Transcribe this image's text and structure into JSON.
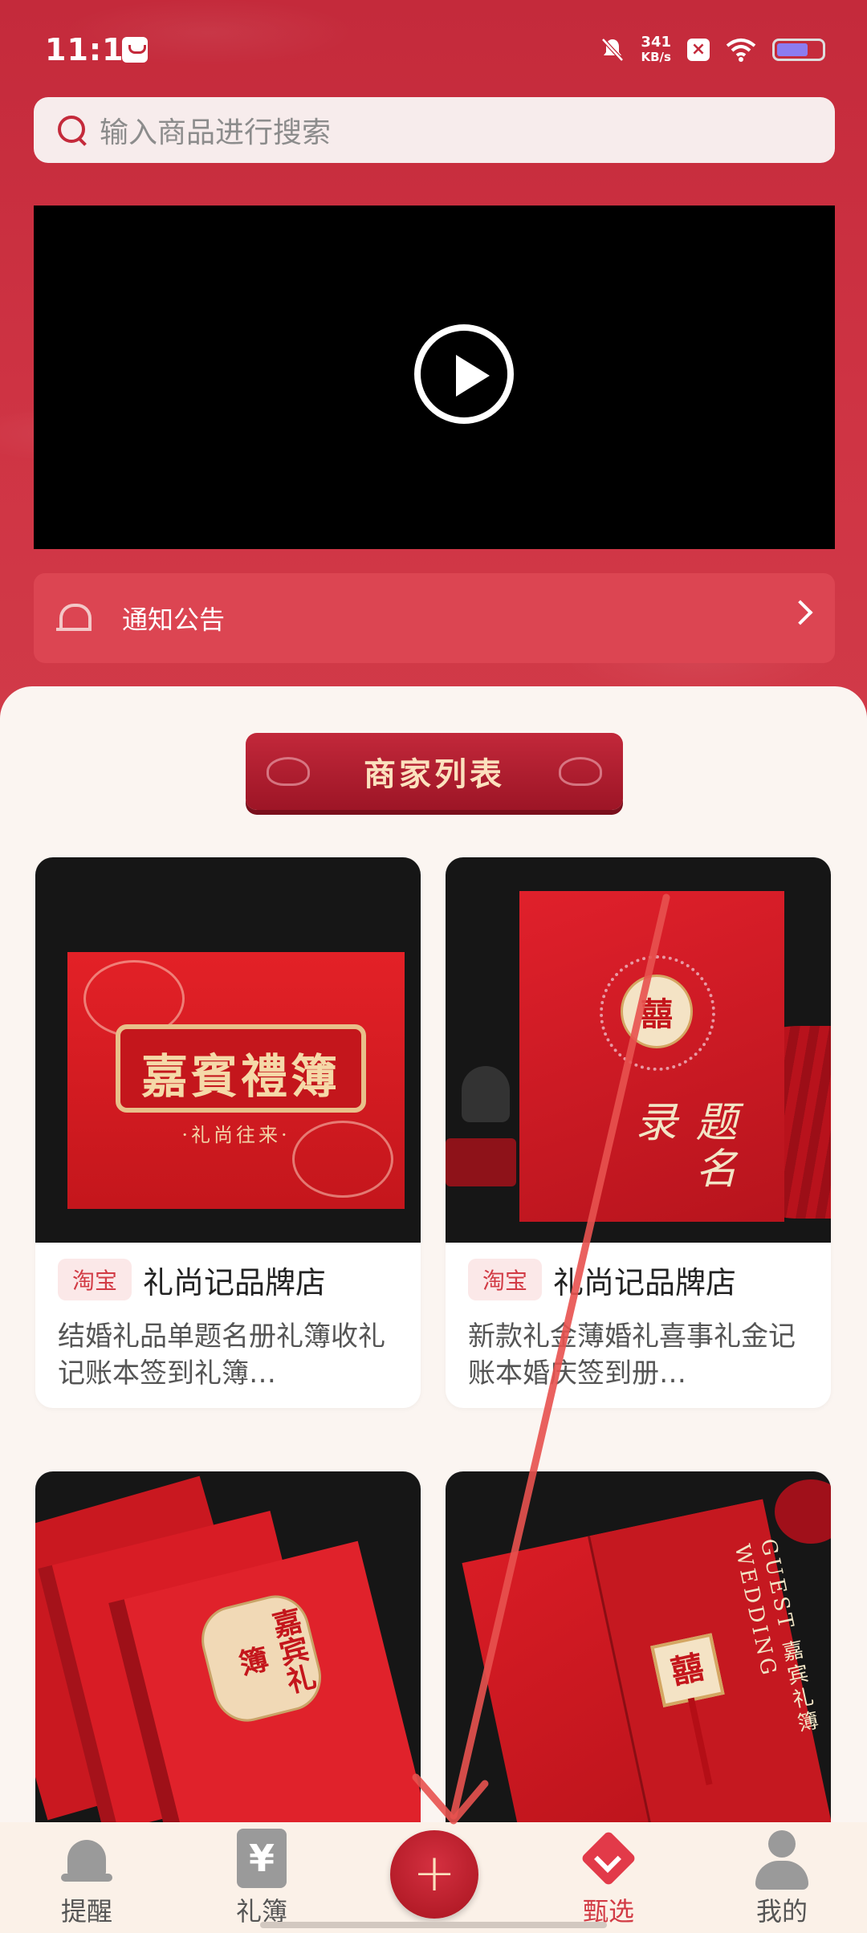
{
  "status_bar": {
    "time": "11:18",
    "net_speed_value": "341",
    "net_speed_unit": "KB/s",
    "battery_level": 0.7
  },
  "search": {
    "placeholder": "输入商品进行搜索"
  },
  "video": {
    "icon": "play-icon"
  },
  "notice": {
    "label": "通知公告"
  },
  "section": {
    "title": "商家列表"
  },
  "products": [
    {
      "tag": "淘宝",
      "shop": "礼尚记品牌店",
      "desc": "结婚礼品单题名册礼簿收礼记账本签到礼簿…",
      "art_title": "嘉賓禮簿",
      "art_sub": "·礼尚往来·"
    },
    {
      "tag": "淘宝",
      "shop": "礼尚记品牌店",
      "desc": "新款礼金薄婚礼喜事礼金记账本婚庆签到册…",
      "art_title": "囍",
      "art_sub": "题名录"
    },
    {
      "art_title": "嘉宾礼簿"
    },
    {
      "art_title": "囍",
      "art_sub": "GUEST 嘉宾礼簿 WEDDING"
    }
  ],
  "bottom_nav": [
    {
      "label": "提醒",
      "icon": "bell-icon"
    },
    {
      "label": "礼簿",
      "icon": "yuan-book-icon"
    },
    {
      "label": "",
      "icon": "plus-icon"
    },
    {
      "label": "甄选",
      "icon": "diamond-check-icon",
      "active": true
    },
    {
      "label": "我的",
      "icon": "user-icon"
    }
  ],
  "colors": {
    "primary": "#c42a3b",
    "accent": "#d23b45",
    "panel": "#fbf5f1",
    "annotation": "#e8524f"
  }
}
